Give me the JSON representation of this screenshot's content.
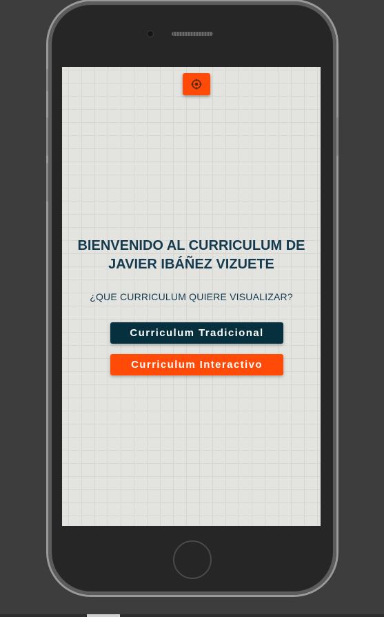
{
  "screen": {
    "settings_icon": "gear-icon",
    "title": "BIENVENIDO AL CURRICULUM DE\nJAVIER IBÁÑEZ VIZUETE",
    "question": "¿QUE CURRICULUM QUIERE VISUALIZAR?",
    "buttons": {
      "traditional": "Curriculum Tradicional",
      "interactive": "Curriculum Interactivo"
    }
  },
  "colors": {
    "accent_orange": "#ff4a08",
    "dark_navy": "#07303f",
    "title_text": "#133a4e",
    "screen_background": "#e3e3df"
  }
}
